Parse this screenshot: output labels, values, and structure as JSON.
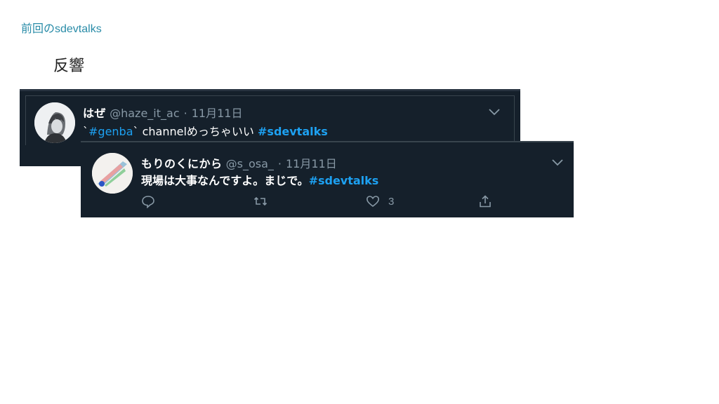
{
  "slide": {
    "header": "前回のsdevtalks",
    "title": "反響"
  },
  "tweets": [
    {
      "name": "はぜ",
      "handle": "@haze_it_ac",
      "separator": "·",
      "date": "11月11日",
      "body_prefix": "`",
      "body_link": "#genba",
      "body_middle": "` channelめっちゃいい ",
      "body_hashtag": "#sdevtalks"
    },
    {
      "name": "もりのくにから",
      "handle": "@s_osa_",
      "separator": "·",
      "date": "11月11日",
      "body_text": "現場は大事なんですよ。まじで。",
      "body_hashtag": "#sdevtalks",
      "like_count": "3"
    }
  ],
  "colors": {
    "tweet_bg": "#15202b",
    "accent": "#1da1f2",
    "muted": "#8899a6",
    "header": "#2a8ca8"
  },
  "icons": [
    "chevron-down-icon",
    "reply-icon",
    "retweet-icon",
    "like-icon",
    "share-icon"
  ]
}
